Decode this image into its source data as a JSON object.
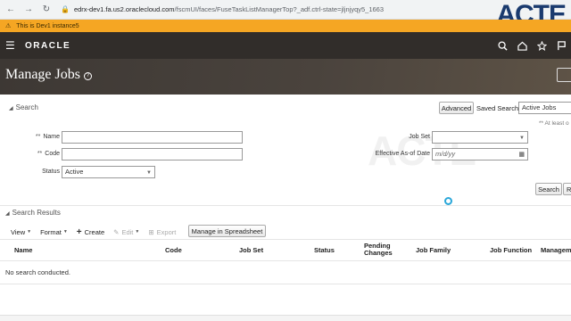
{
  "browser": {
    "back_icon": "back-arrow-icon",
    "forward_icon": "forward-arrow-icon",
    "reload_icon": "reload-icon",
    "url_domain": "edrx-dev1.fa.us2.oraclecloud.com",
    "url_path": "/fscmUI/faces/FuseTaskListManagerTop?_adf.ctrl-state=jljnjyqy5_1663"
  },
  "brand": {
    "logo_text": "ACTE"
  },
  "warning": {
    "text": "This is Dev1 instance5"
  },
  "header": {
    "logo": "ORACLE",
    "icons": [
      "search-icon",
      "home-icon",
      "star-icon",
      "flag-icon"
    ]
  },
  "page": {
    "title": "Manage Jobs"
  },
  "search": {
    "heading": "Search",
    "advanced_label": "Advanced",
    "saved_search_label": "Saved Search",
    "saved_search_value": "Active Jobs",
    "at_least_text": "** At least o",
    "required_marker": "**",
    "name_label": "Name",
    "name_value": "",
    "code_label": "Code",
    "code_value": "",
    "status_label": "Status",
    "status_value": "Active",
    "job_set_label": "Job Set",
    "job_set_value": "",
    "effective_label": "Effective As-of Date",
    "effective_placeholder": "m/d/yy",
    "search_button": "Search",
    "reset_button": "R"
  },
  "watermark": {
    "text": "ACTE"
  },
  "results": {
    "heading": "Search Results",
    "toolbar": {
      "view": "View",
      "format": "Format",
      "create": "Create",
      "edit": "Edit",
      "export": "Export",
      "manage_spreadsheet": "Manage in Spreadsheet"
    },
    "columns": [
      "Name",
      "Code",
      "Job Set",
      "Status",
      "Pending Changes",
      "Job Family",
      "Job Function",
      "Managem"
    ],
    "empty_message": "No search conducted."
  }
}
